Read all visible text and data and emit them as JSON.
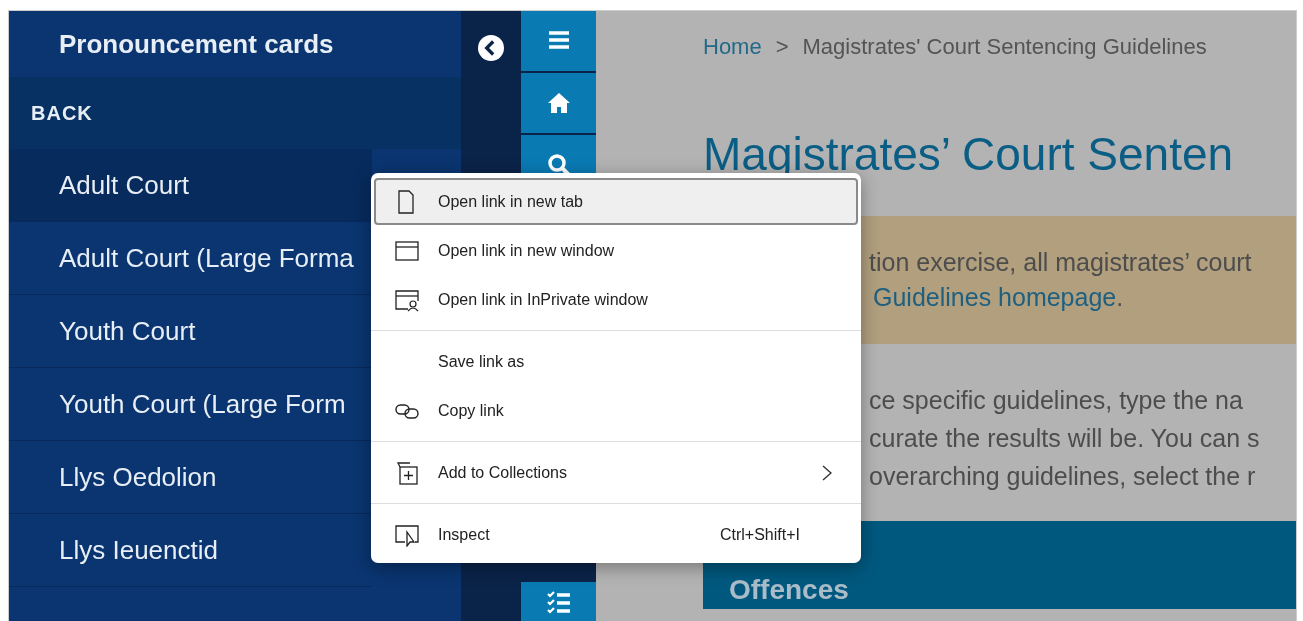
{
  "sidebar": {
    "title": "Pronouncement cards",
    "back": "BACK",
    "items": [
      {
        "label": "Adult Court",
        "selected": true
      },
      {
        "label": "Adult Court (Large Forma",
        "selected": false
      },
      {
        "label": "Youth Court",
        "selected": false
      },
      {
        "label": "Youth Court (Large Form",
        "selected": false
      },
      {
        "label": "Llys Oedolion",
        "selected": false
      },
      {
        "label": "Llys Ieuenctid",
        "selected": false
      }
    ]
  },
  "rail": {
    "top_buttons": [
      {
        "kind": "menu"
      },
      {
        "kind": "home"
      },
      {
        "kind": "search"
      }
    ],
    "bottom_buttons": [
      {
        "kind": "checklist"
      }
    ]
  },
  "breadcrumb": {
    "home": "Home",
    "separator": ">",
    "current": "Magistrates' Court Sentencing Guidelines"
  },
  "heading": "Magistrates’ Court Senten",
  "notice": {
    "text": "tion exercise, all magistrates’ court",
    "link": "Guidelines homepage",
    "after": "."
  },
  "paragraph": [
    "ce specific guidelines, type the na",
    "curate the results will be. You can s",
    "overarching guidelines, select the r"
  ],
  "section_bar": {
    "title": "Offences"
  },
  "context_menu": {
    "groups": [
      [
        {
          "kind": "page",
          "label": "Open link in new tab",
          "selected": true
        },
        {
          "kind": "window",
          "label": "Open link in new window",
          "selected": false
        },
        {
          "kind": "private-window",
          "label": "Open link in InPrivate window",
          "selected": false
        }
      ],
      [
        {
          "kind": "none",
          "label": "Save link as",
          "selected": false
        },
        {
          "kind": "link",
          "label": "Copy link",
          "selected": false
        }
      ],
      [
        {
          "kind": "collection",
          "label": "Add to Collections",
          "selected": false,
          "submenu": true
        }
      ],
      [
        {
          "kind": "inspect",
          "label": "Inspect",
          "selected": false,
          "shortcut": "Ctrl+Shift+I"
        }
      ]
    ]
  }
}
